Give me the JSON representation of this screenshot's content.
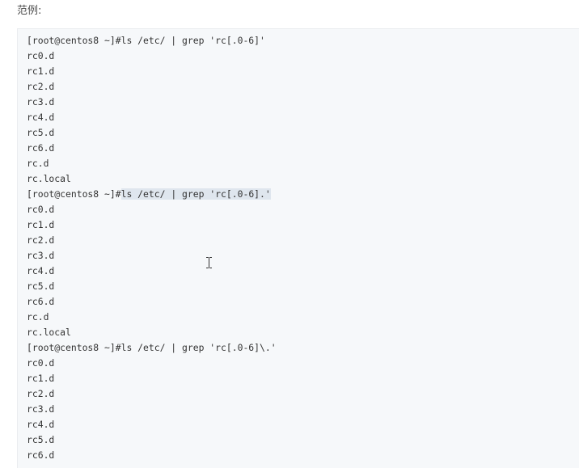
{
  "heading": "范例:",
  "code": {
    "lines": [
      "[root@centos8 ~]#ls /etc/ | grep 'rc[.0-6]'",
      "rc0.d",
      "rc1.d",
      "rc2.d",
      "rc3.d",
      "rc4.d",
      "rc5.d",
      "rc6.d",
      "rc.d",
      "rc.local",
      "[root@centos8 ~]#ls /etc/ | grep 'rc[.0-6].'",
      "rc0.d",
      "rc1.d",
      "rc2.d",
      "rc3.d",
      "rc4.d",
      "rc5.d",
      "rc6.d",
      "rc.d",
      "rc.local",
      "[root@centos8 ~]#ls /etc/ | grep 'rc[.0-6]\\.'",
      "rc0.d",
      "rc1.d",
      "rc2.d",
      "rc3.d",
      "rc4.d",
      "rc5.d",
      "rc6.d"
    ],
    "selection": {
      "line_index": 10,
      "prefix": "[root@centos8 ~]#",
      "selected": "ls /etc/ | grep 'rc[.0-6].'"
    }
  },
  "cursor_icon": "text-cursor-icon"
}
